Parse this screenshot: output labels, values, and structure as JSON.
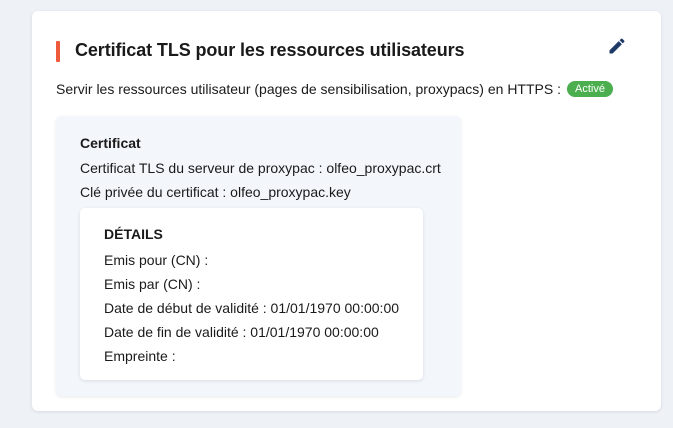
{
  "section": {
    "title": "Certificat TLS pour les ressources utilisateurs",
    "accent_color": "#ef5a3c",
    "edit_icon": "pencil-icon",
    "edit_icon_color": "#1e3a66"
  },
  "https": {
    "label": "Servir les ressources utilisateur (pages de sensibilisation, proxypacs) en HTTPS :",
    "status": "Activé",
    "status_color": "#4bae4f"
  },
  "certificate": {
    "title": "Certificat",
    "server_cert": "Certificat TLS du serveur de proxypac : olfeo_proxypac.crt",
    "private_key": "Clé privée du certificat : olfeo_proxypac.key"
  },
  "details": {
    "title": "DÉTAILS",
    "issued_to": "Emis pour (CN) :",
    "issued_by": "Emis par (CN) :",
    "valid_from": "Date de début de validité : 01/01/1970 00:00:00",
    "valid_to": "Date de fin de validité : 01/01/1970 00:00:00",
    "fingerprint": "Empreinte :"
  }
}
